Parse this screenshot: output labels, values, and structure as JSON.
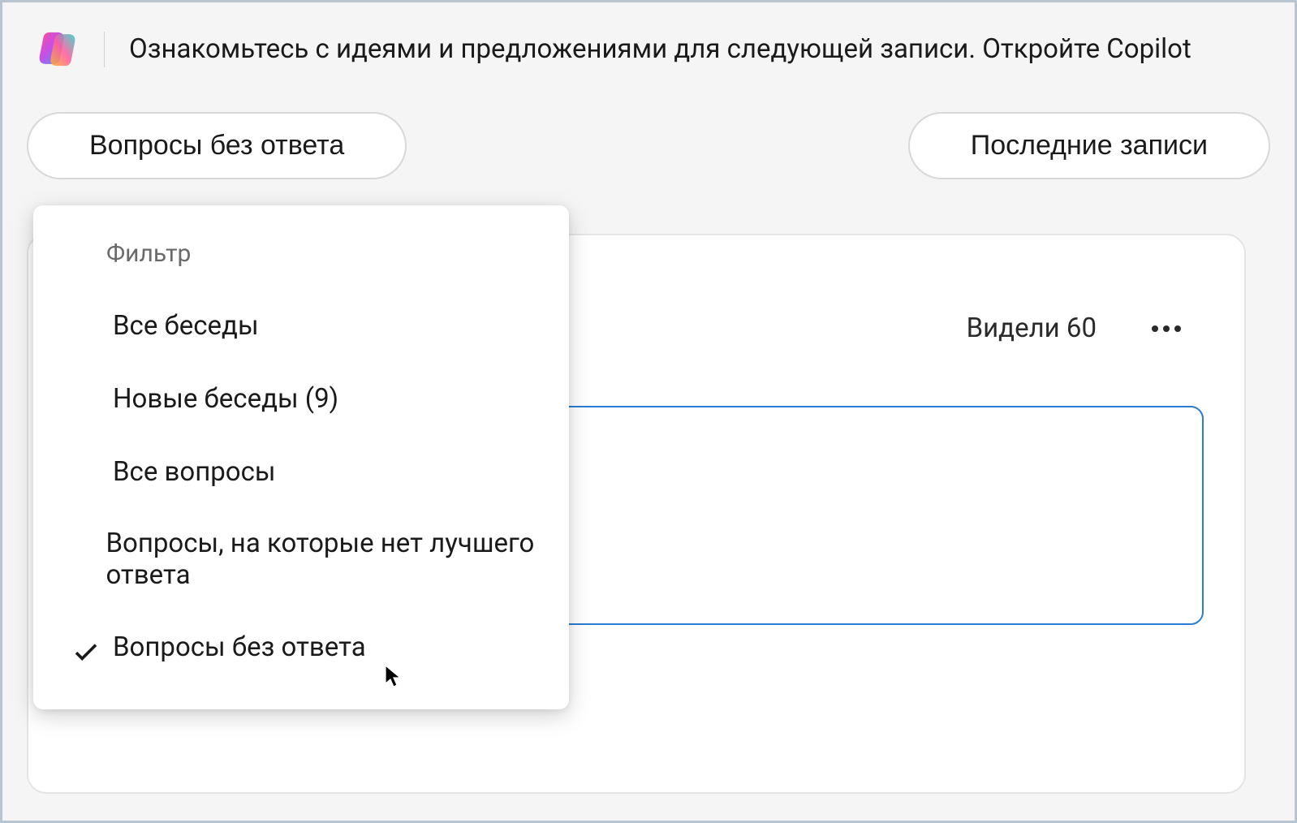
{
  "header": {
    "banner_text": "Ознакомьтесь с идеями и предложениями для следующей записи. Откройте Copilot"
  },
  "pills": {
    "left_label": "Вопросы без ответа",
    "right_label": "Последние записи"
  },
  "card": {
    "seen_label": "Видели 60"
  },
  "dropdown": {
    "header": "Фильтр",
    "items": [
      {
        "label": "Все беседы",
        "selected": false
      },
      {
        "label": "Новые беседы (9)",
        "selected": false
      },
      {
        "label": "Все вопросы",
        "selected": false
      },
      {
        "label": "Вопросы, на которые нет лучшего ответа",
        "selected": false
      },
      {
        "label": "Вопросы без ответа",
        "selected": true
      }
    ]
  },
  "colors": {
    "accent": "#2b7cd3",
    "border": "#d8d8d8",
    "bg": "#f5f5f5"
  }
}
